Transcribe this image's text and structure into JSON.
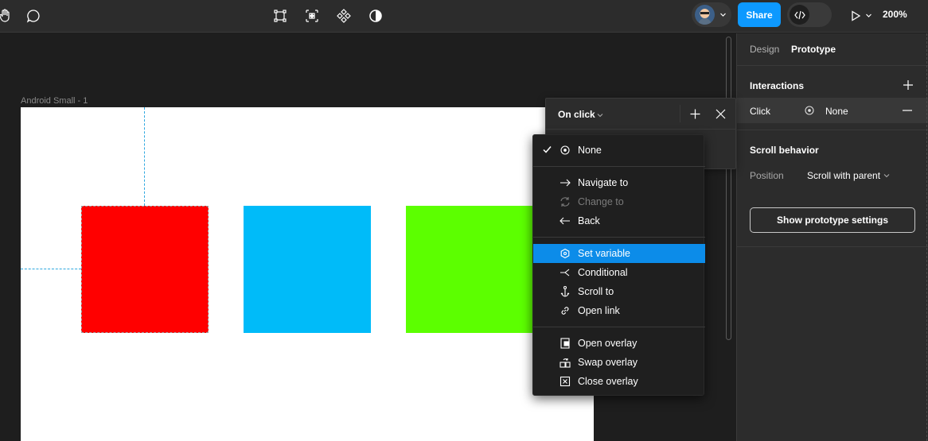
{
  "toolbar": {
    "share_label": "Share",
    "zoom": "200%",
    "icons": [
      "hand-icon",
      "comment-icon",
      "frame-tool-icon",
      "component-grid-icon",
      "components-icon",
      "contrast-icon",
      "play-icon",
      "code-icon"
    ]
  },
  "canvas": {
    "frame_label": "Android Small - 1",
    "colors": {
      "red": "#ff0000",
      "blue": "#00bbf9",
      "green": "#5cff00",
      "guide": "#2fa8e0"
    }
  },
  "panel": {
    "tabs": [
      "Design",
      "Prototype"
    ],
    "interactions_title": "Interactions",
    "click_trigger": "Click",
    "click_action": "None",
    "scroll_title": "Scroll behavior",
    "position_label": "Position",
    "position_value": "Scroll with parent",
    "settings_button": "Show prototype settings"
  },
  "popover": {
    "trigger_label": "On click"
  },
  "menu": {
    "items": [
      {
        "label": "None",
        "icon": "target-icon",
        "checked": true
      },
      {
        "label": "Navigate to",
        "icon": "arrow-right-icon"
      },
      {
        "label": "Change to",
        "icon": "swap-cycle-icon",
        "disabled": true
      },
      {
        "label": "Back",
        "icon": "arrow-left-icon"
      },
      {
        "label": "Set variable",
        "icon": "variable-icon",
        "selected": true
      },
      {
        "label": "Conditional",
        "icon": "branch-icon"
      },
      {
        "label": "Scroll to",
        "icon": "anchor-icon"
      },
      {
        "label": "Open link",
        "icon": "link-icon"
      },
      {
        "label": "Open overlay",
        "icon": "open-overlay-icon"
      },
      {
        "label": "Swap overlay",
        "icon": "swap-overlay-icon"
      },
      {
        "label": "Close overlay",
        "icon": "close-overlay-icon"
      }
    ]
  }
}
